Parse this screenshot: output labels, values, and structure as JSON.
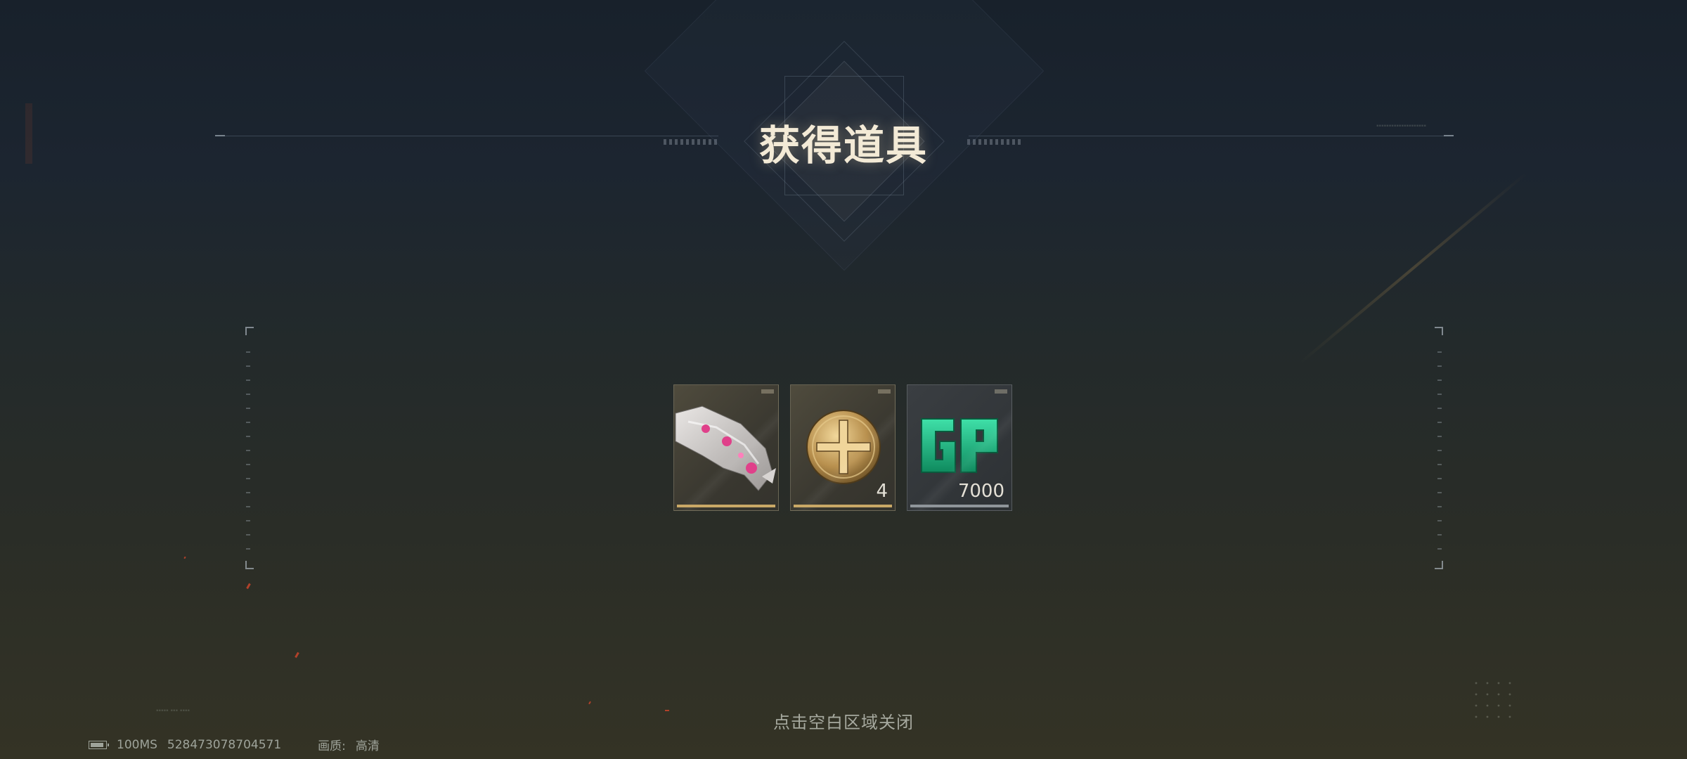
{
  "dialog": {
    "title": "获得道具",
    "close_hint": "点击空白区域关闭"
  },
  "items": [
    {
      "name": "weapon-skin",
      "rarity_color": "#c9a866",
      "quantity": ""
    },
    {
      "name": "gold-coin-medal",
      "rarity_color": "#c9a866",
      "quantity": "4"
    },
    {
      "name": "gp-currency",
      "rarity_color": "#8f959a",
      "quantity": "7000"
    }
  ],
  "status_bar": {
    "latency": "100MS",
    "player_id": "528473078704571",
    "quality_label": "画质:",
    "quality_value": "高清"
  },
  "colors": {
    "title": "#f3ead6",
    "gp_green": "#1fb982",
    "gold": "#c9a866"
  }
}
